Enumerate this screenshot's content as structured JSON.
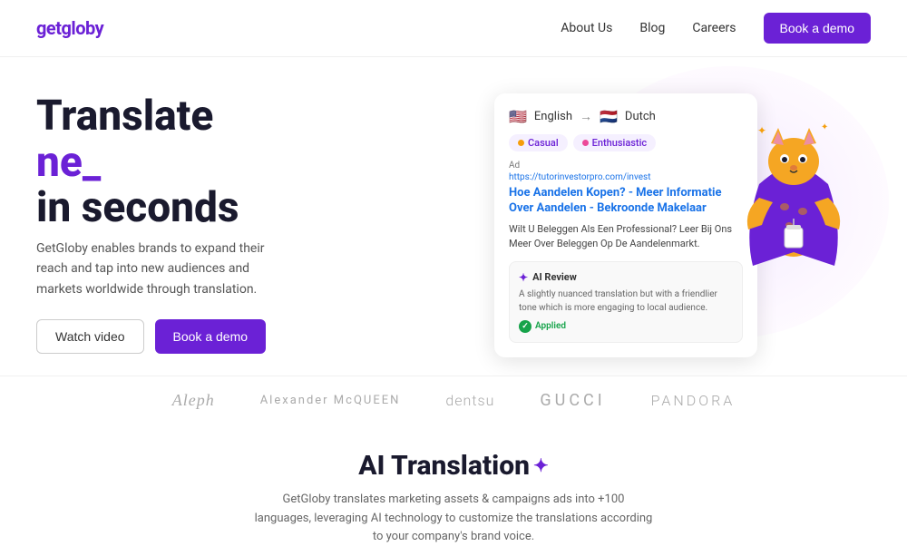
{
  "nav": {
    "logo": "getgloby",
    "links": [
      {
        "label": "About Us",
        "id": "about-us"
      },
      {
        "label": "Blog",
        "id": "blog"
      },
      {
        "label": "Careers",
        "id": "careers"
      }
    ],
    "cta": "Book a demo"
  },
  "hero": {
    "title_line1": "Translate",
    "title_line2": "ne_",
    "title_line3": "in seconds",
    "subtitle": "GetGloby enables brands to expand their reach and tap into new audiences and markets worldwide through translation.",
    "watch_label": "Watch video",
    "book_label": "Book a demo"
  },
  "translation_card": {
    "source_lang": "English",
    "target_lang": "Dutch",
    "source_flag": "🇺🇸",
    "target_flag": "🇳🇱",
    "tags": [
      "Casual",
      "Enthusiastic"
    ],
    "ad_label": "Ad",
    "ad_url": "https://tutorinvestorpro.com/invest",
    "ad_title": "Hoe Aandelen Kopen? - Meer Informatie Over Aandelen - Bekroonde Makelaar",
    "ad_body": "Wilt U Beleggen Als Een Professional? Leer Bij Ons Meer Over Beleggen Op De Aandelenmarkt.",
    "ai_review_header": "AI Review",
    "ai_review_text": "A slightly nuanced translation but with a friendlier tone which is more engaging to local audience.",
    "applied_label": "Applied"
  },
  "logos": [
    {
      "name": "Aleph",
      "class": "aleph"
    },
    {
      "name": "Alexander McQUEEN",
      "class": "mcqueen"
    },
    {
      "name": "dentsu",
      "class": "dentsu"
    },
    {
      "name": "GUCCI",
      "class": "gucci"
    },
    {
      "name": "PANDORA",
      "class": "pandora"
    }
  ],
  "ai_section": {
    "title": "AI Translation",
    "description": "GetGloby translates marketing assets & campaigns ads into +100 languages, leveraging AI technology to customize the translations according to your company's brand voice."
  }
}
